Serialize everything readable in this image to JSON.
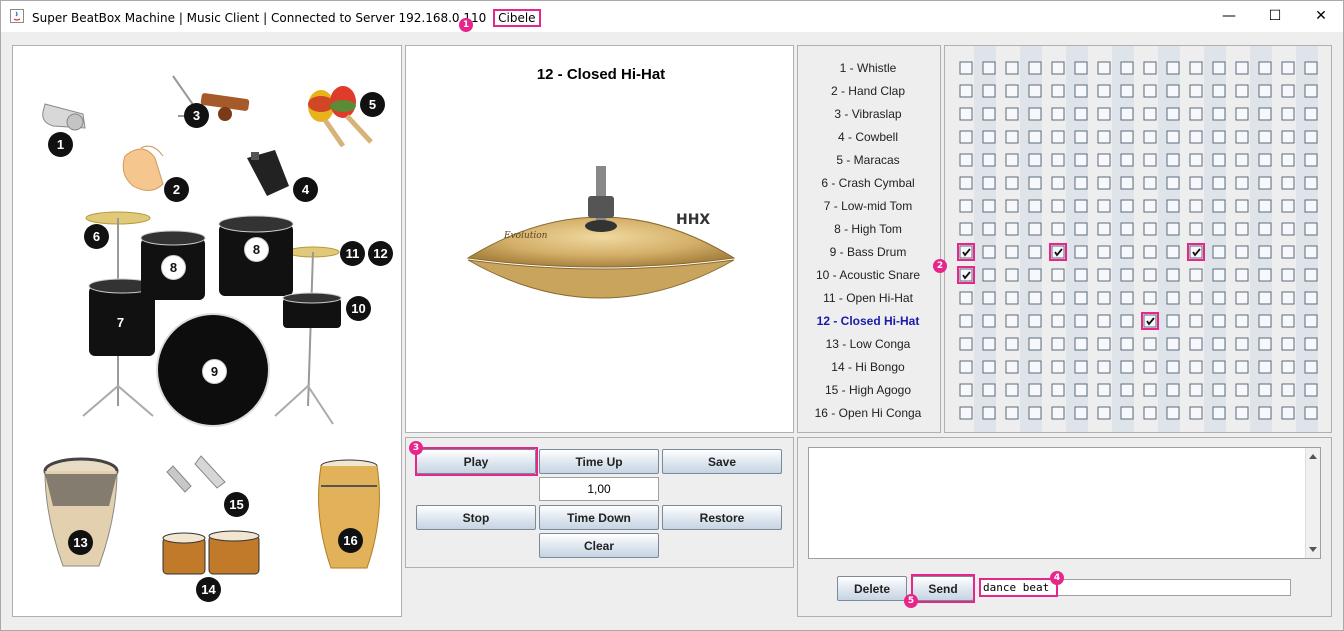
{
  "window": {
    "title": "Super BeatBox Machine | Music Client | Connected to Server 192.168.0.110",
    "user": "Cibele",
    "controls": {
      "minimize": "—",
      "maximize": "☐",
      "close": "✕"
    }
  },
  "annotations": [
    "1",
    "2",
    "3",
    "4",
    "5"
  ],
  "drum_kit": {
    "numbers": [
      "1",
      "2",
      "3",
      "4",
      "5",
      "6",
      "7",
      "8",
      "8",
      "9",
      "10",
      "11",
      "12",
      "13",
      "14",
      "15",
      "16"
    ]
  },
  "preview": {
    "title": "12 - Closed Hi-Hat",
    "cymbal_brand": "HHX",
    "cymbal_text": "Evolution"
  },
  "controls": {
    "play": "Play",
    "time_up": "Time Up",
    "save": "Save",
    "tempo": "1,00",
    "stop": "Stop",
    "time_down": "Time Down",
    "restore": "Restore",
    "clear": "Clear"
  },
  "instruments": [
    "1 - Whistle",
    "2 - Hand Clap",
    "3 - Vibraslap",
    "4 - Cowbell",
    "5 - Maracas",
    "6 - Crash Cymbal",
    "7 - Low-mid Tom",
    "8 - High Tom",
    "9 - Bass Drum",
    "10 - Acoustic Snare",
    "11 - Open Hi-Hat",
    "12 - Closed Hi-Hat",
    "13 - Low Conga",
    "14 - Hi Bongo",
    "15 - High Agogo",
    "16 - Open Hi Conga"
  ],
  "selected_instrument_index": 11,
  "beat_grid": {
    "rows": 16,
    "cols": 16,
    "checked": [
      [
        8,
        0
      ],
      [
        8,
        4
      ],
      [
        8,
        10
      ],
      [
        9,
        0
      ],
      [
        11,
        8
      ]
    ]
  },
  "chat": {
    "messages": "",
    "delete": "Delete",
    "send": "Send",
    "input_value": "dance beat"
  },
  "colors": {
    "highlight": "#e6268a",
    "selected_text": "#1a1aa8"
  }
}
